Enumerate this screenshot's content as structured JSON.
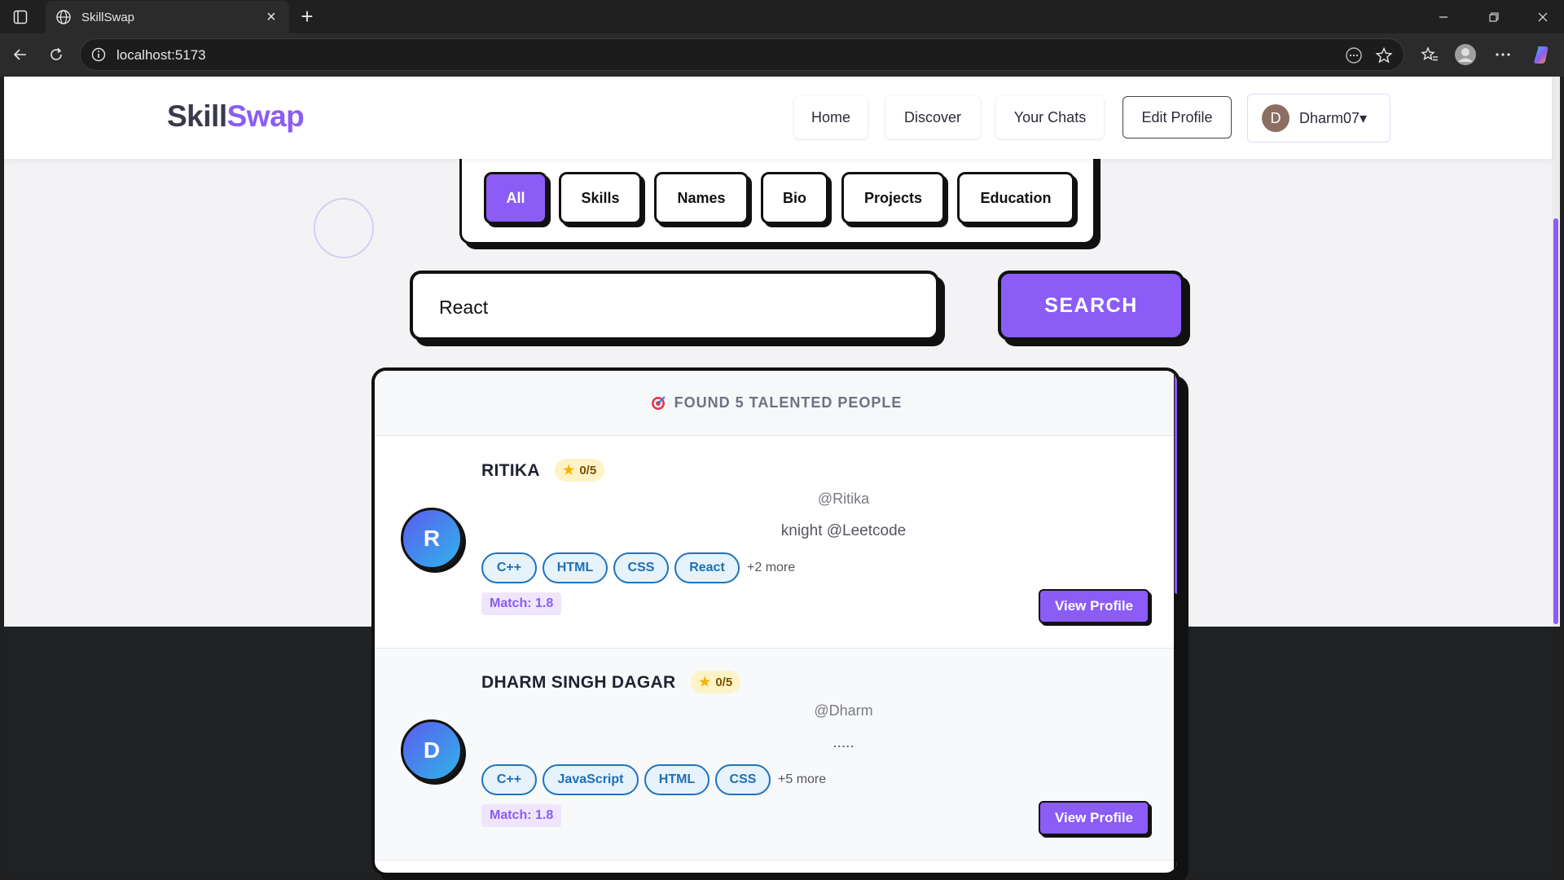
{
  "browser": {
    "tab_title": "SkillSwap",
    "url": "localhost:5173"
  },
  "nav": {
    "logo_part1": "Skill",
    "logo_part2": "Swap",
    "home": "Home",
    "discover": "Discover",
    "chats": "Your Chats",
    "edit_profile": "Edit Profile",
    "user_initial": "D",
    "username": "Dharm07",
    "user_caret": "▾"
  },
  "filters": [
    "All",
    "Skills",
    "Names",
    "Bio",
    "Projects",
    "Education"
  ],
  "filter_active": "All",
  "search": {
    "value": "React",
    "button": "SEARCH"
  },
  "results": {
    "header": "FOUND 5 TALENTED PEOPLE",
    "cards": [
      {
        "initial": "R",
        "name": "RITIKA",
        "rating": "0/5",
        "username": "@Ritika",
        "bio": "knight @Leetcode",
        "tags": [
          "C++",
          "HTML",
          "CSS",
          "React"
        ],
        "more": "+2 more",
        "match": "Match: 1.8",
        "button": "View Profile"
      },
      {
        "initial": "D",
        "name": "DHARM SINGH DAGAR",
        "rating": "0/5",
        "username": "@Dharm",
        "bio": ".....",
        "tags": [
          "C++",
          "JavaScript",
          "HTML",
          "CSS"
        ],
        "more": "+5 more",
        "match": "Match: 1.8",
        "button": "View Profile"
      }
    ]
  },
  "colors": {
    "accent": "#8b5cf6",
    "ink": "#111111",
    "tag_blue": "#1e73be"
  }
}
